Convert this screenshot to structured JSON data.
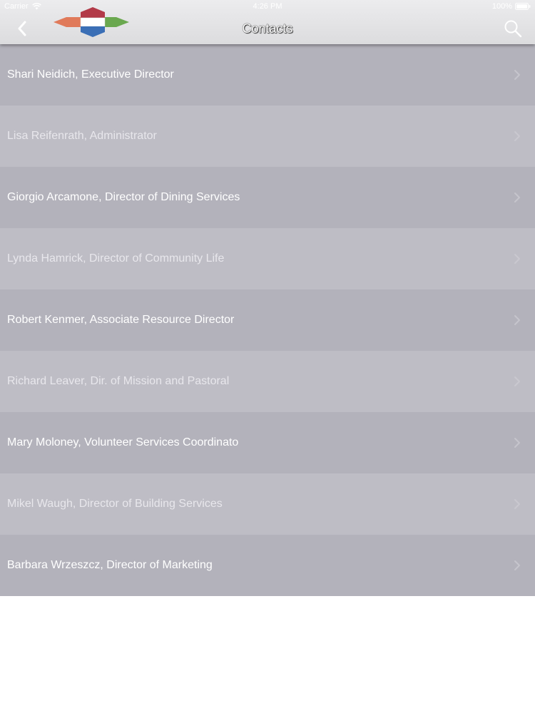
{
  "status_bar": {
    "carrier": "Carrier",
    "time": "4:26 PM",
    "battery": "100%"
  },
  "nav": {
    "title": "Contacts",
    "back_icon": "chevron-left-icon",
    "search_icon": "search-icon"
  },
  "contacts": [
    {
      "label": "Shari Neidich, Executive Director"
    },
    {
      "label": "Lisa Reifenrath, Administrator"
    },
    {
      "label": "Giorgio Arcamone, Director of Dining Services"
    },
    {
      "label": "Lynda Hamrick, Director of Community Life"
    },
    {
      "label": "Robert Kenmer, Associate Resource Director"
    },
    {
      "label": "Richard Leaver, Dir. of Mission and Pastoral"
    },
    {
      "label": "Mary Moloney, Volunteer Services Coordinato"
    },
    {
      "label": "Mikel Waugh, Director of Building Services"
    },
    {
      "label": "Barbara Wrzeszcz, Director of Marketing"
    }
  ],
  "colors": {
    "row_dark": "#b3b2bb",
    "row_light": "#bebdc5",
    "logo_red": "#b23a48",
    "logo_orange": "#e07a5a",
    "logo_green": "#6aa84f",
    "logo_blue": "#3b6fb6"
  }
}
